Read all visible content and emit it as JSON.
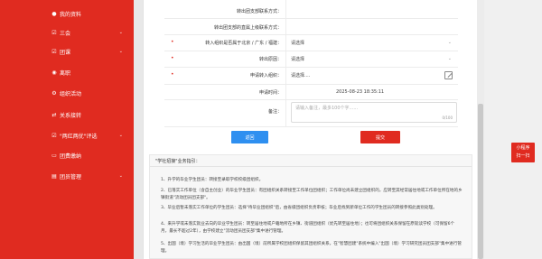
{
  "sidebar": {
    "items": [
      {
        "label": "我的资料",
        "icon": "user-icon",
        "chevron": false
      },
      {
        "label": "三会",
        "icon": "check-square-icon",
        "chevron": true
      },
      {
        "label": "团课",
        "icon": "check-square-icon",
        "chevron": true
      },
      {
        "label": "离职",
        "icon": "building-icon",
        "chevron": false
      },
      {
        "label": "组织活动",
        "icon": "gear-icon",
        "chevron": false
      },
      {
        "label": "关系接转",
        "icon": "transfer-icon",
        "chevron": false
      },
      {
        "label": "\"两红两优\"评选",
        "icon": "check-square-icon",
        "chevron": true
      },
      {
        "label": "团费缴纳",
        "icon": "card-icon",
        "chevron": false
      },
      {
        "label": "团员管理",
        "icon": "file-icon",
        "chevron": true
      }
    ]
  },
  "form": {
    "rows": [
      {
        "label": "转出团支部联系方式：",
        "value": "",
        "required": false
      },
      {
        "label": "转出团支部的直属上级联系方式：",
        "value": "",
        "required": false
      },
      {
        "label": "转入组织是否属于北京 / 广东 / 福建：",
        "value": "请选择",
        "required": true,
        "type": "select"
      },
      {
        "label": "转出原因：",
        "value": "请选择",
        "required": true,
        "type": "select"
      },
      {
        "label": "申请转入组织：",
        "value": "请选择....",
        "required": true,
        "type": "picker"
      },
      {
        "label": "申请时间：",
        "value": "2025-08-23 18:35:11",
        "required": false
      },
      {
        "label": "备注：",
        "value": "",
        "required": false
      }
    ],
    "remark_placeholder": "请输入备注，最多100个字......",
    "remark_counter": "0/100"
  },
  "buttons": {
    "back": "返回",
    "submit": "提交"
  },
  "guide": {
    "title": "\"学社招接\"业务指引：",
    "items": [
      "1、升学的毕业学生团员：转接至录取学校校级团组织。",
      "2、已落实工作单位（含自主创业）的毕业学生团员：有团组织关系转接至工作单位团组织；工作单位尚未建立团组织的，应转至其经常居住地或工作单位所在地的乡镇街道\"流动团员团支部\"。",
      "3、毕业后暂未落实工作单位的学生团员：选择\"待毕业团组织\"后，由省级团组织负责审核；毕业后找到新单位工作的学生团员的转接参照此类别处理。",
      "4、来升学或未落实就业去向的毕业学生团员：转至居住地或户籍地所在乡镇、街道团组织（优先转至居住地）；也可将团组织关系保留在原就读学校（可保留6个月，最长不超过2年），由学校建立\"流动团员团支部\"集中进行管理。",
      "5、出国（境）学习生活的毕业学生团员：由出国（境）前所属学校团组织保留其团组织关系，在\"智慧团建\"系统中编入\"出国（境）学习研究团员团支部\"集中进行管理。"
    ]
  },
  "floating": {
    "scan_label_line1": "小程序",
    "scan_label_line2": "扫一扫"
  },
  "colors": {
    "brand_red": "#e02b20",
    "back_blue": "#2e8ff0"
  }
}
